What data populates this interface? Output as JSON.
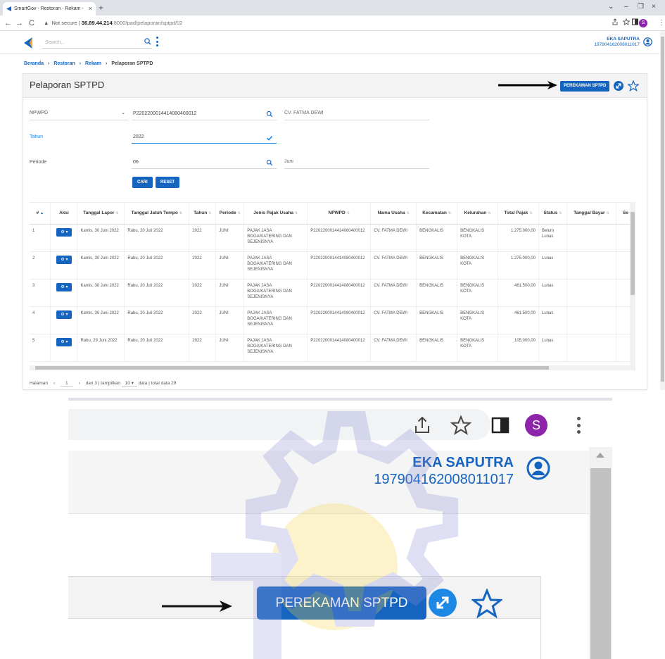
{
  "browser": {
    "tab_title": "SmartGov - Restoran - Rekam - ",
    "tab_close": "×",
    "new_tab": "+",
    "nav": {
      "back": "←",
      "forward": "→",
      "reload": "C"
    },
    "address": {
      "warning_icon": "▲",
      "security": "Not secure",
      "separator": "|",
      "host": "36.89.44.214",
      "path": ":8000/pad/pelaporan/sptpd/02"
    },
    "icons": [
      "share-icon",
      "star-icon",
      "sidepanel-icon",
      "profile-icon"
    ],
    "window_controls": [
      "⌄",
      "–",
      "❐",
      "×"
    ],
    "profile_letter": "S"
  },
  "app": {
    "search_placeholder": "Search...",
    "user": {
      "name": "EKA SAPUTRA",
      "nip": "197904162008011017"
    },
    "accent": "#1565c0"
  },
  "breadcrumb": {
    "items": [
      "Beranda",
      "Restoran",
      "Rekam"
    ],
    "current": "Pelaporan SPTPD",
    "separator": "›"
  },
  "page": {
    "title": "Pelaporan SPTPD",
    "primary_button": "PEREKAMAN SPTPD"
  },
  "form": {
    "npwpd": {
      "label": "NPWPD",
      "value": "P2202200014414080400012",
      "name_result": "CV. FATMA DEWI"
    },
    "tahun": {
      "label": "Tahun",
      "value": "2022"
    },
    "periode": {
      "label": "Periode",
      "value": "06",
      "month_result": "Juni"
    },
    "buttons": {
      "search": "CARI",
      "reset": "RESET"
    }
  },
  "table": {
    "columns": [
      "#",
      "Aksi",
      "Tanggal Lapor",
      "Tanggal Jatuh Tempo",
      "Tahun",
      "Periode",
      "Jenis Pajak Usaha",
      "NPWPD",
      "Nama Usaha",
      "Kecamatan",
      "Kelurahan",
      "Total Pajak",
      "Status",
      "Tanggal Bayar",
      "Se"
    ],
    "action_label": "⚙ ▾",
    "rows": [
      {
        "no": "1",
        "tanggal_lapor": "Kamis, 30 Juni 2022",
        "jatuh_tempo": "Rabu, 20 Juli 2022",
        "tahun": "2022",
        "periode": "JUNI",
        "jenis": "PAJAK JASA BOGA/KATERING DAN SEJENISNYA",
        "npwpd": "P2202200014414080400012",
        "nama": "CV. FATMA DEWI",
        "kecamatan": "BENGKALIS",
        "kelurahan": "BENGKALIS KOTA",
        "total": "1.275.000,00",
        "status": "Belum Lunas",
        "tanggal_bayar": ""
      },
      {
        "no": "2",
        "tanggal_lapor": "Kamis, 30 Juni 2022",
        "jatuh_tempo": "Rabu, 20 Juli 2022",
        "tahun": "2022",
        "periode": "JUNI",
        "jenis": "PAJAK JASA BOGA/KATERING DAN SEJENISNYA",
        "npwpd": "P2202200014414080400012",
        "nama": "CV. FATMA DEWI",
        "kecamatan": "BENGKALIS",
        "kelurahan": "BENGKALIS KOTA",
        "total": "1.275.000,00",
        "status": "Lunas",
        "tanggal_bayar": ""
      },
      {
        "no": "3",
        "tanggal_lapor": "Kamis, 30 Juni 2022",
        "jatuh_tempo": "Rabu, 20 Juli 2022",
        "tahun": "2022",
        "periode": "JUNI",
        "jenis": "PAJAK JASA BOGA/KATERING DAN SEJENISNYA",
        "npwpd": "P2202200014414080400012",
        "nama": "CV. FATMA DEWI",
        "kecamatan": "BENGKALIS",
        "kelurahan": "BENGKALIS KOTA",
        "total": "461.500,00",
        "status": "Lunas",
        "tanggal_bayar": ""
      },
      {
        "no": "4",
        "tanggal_lapor": "Kamis, 30 Juni 2022",
        "jatuh_tempo": "Rabu, 20 Juli 2022",
        "tahun": "2022",
        "periode": "JUNI",
        "jenis": "PAJAK JASA BOGA/KATERING DAN SEJENISNYA",
        "npwpd": "P2202200014414080400012",
        "nama": "CV. FATMA DEWI",
        "kecamatan": "BENGKALIS",
        "kelurahan": "BENGKALIS KOTA",
        "total": "461.500,00",
        "status": "Lunas",
        "tanggal_bayar": ""
      },
      {
        "no": "5",
        "tanggal_lapor": "Rabu, 29 Juni 2022",
        "jatuh_tempo": "Rabu, 20 Juli 2022",
        "tahun": "2022",
        "periode": "JUNI",
        "jenis": "PAJAK JASA BOGA/KATERING DAN SEJENISNYA",
        "npwpd": "P2202200014414080400012",
        "nama": "CV. FATMA DEWI",
        "kecamatan": "BENGKALIS",
        "kelurahan": "BENGKALIS KOTA",
        "total": "105.000,00",
        "status": "Lunas",
        "tanggal_bayar": ""
      }
    ]
  },
  "pagination": {
    "label": "Halaman",
    "prev": "‹",
    "page": "1",
    "next": "›",
    "of_pages": "dari 3 | tampilkan",
    "page_size": "10",
    "page_size_caret": "▾",
    "total": "data | total data 29"
  },
  "zoom": {
    "user_name": "EKA SAPUTRA",
    "user_nip": "197904162008011017",
    "profile_letter": "S",
    "button": "PEREKAMAN SPTPD"
  },
  "colors": {
    "primary": "#1565c0",
    "profile": "#8e24aa",
    "bg": "#ffffff"
  }
}
